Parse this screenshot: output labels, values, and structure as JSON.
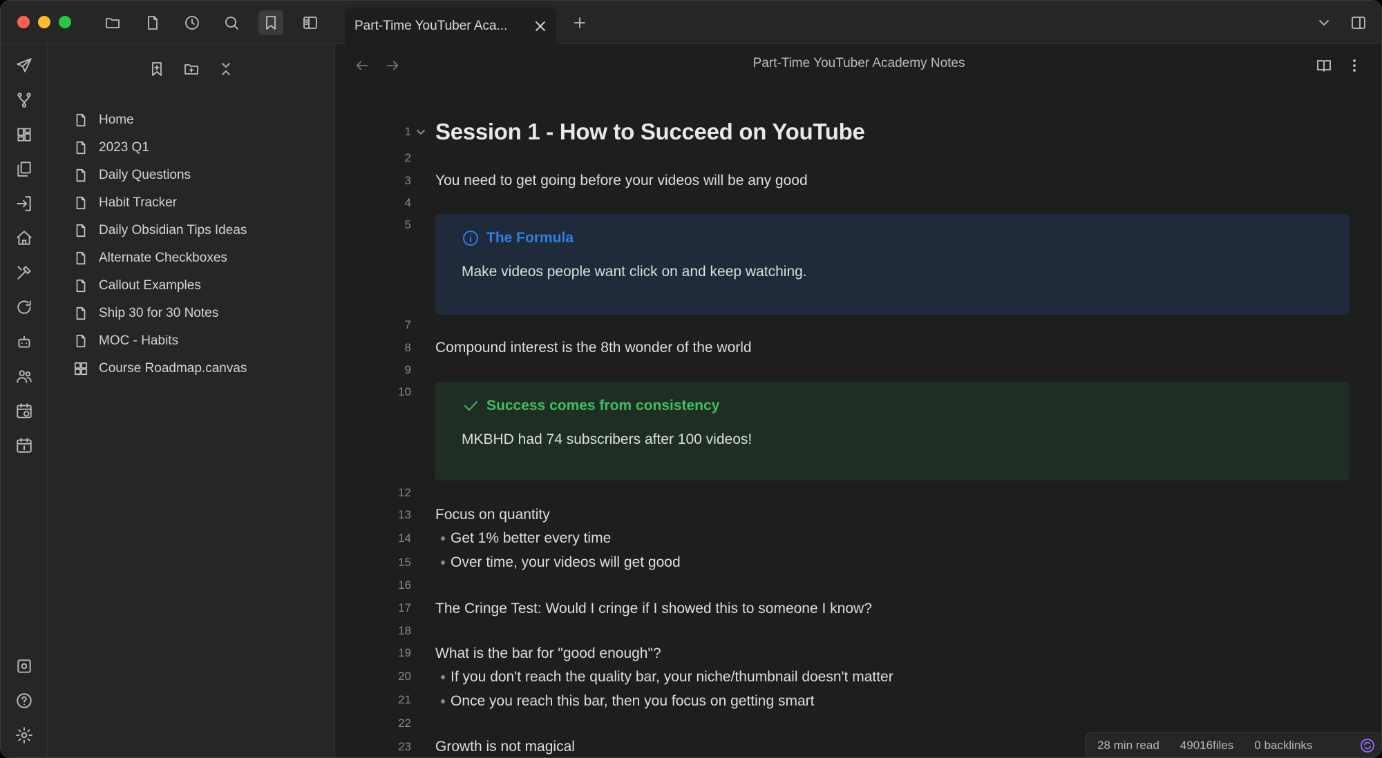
{
  "window": {
    "tab_title": "Part-Time YouTuber Aca...",
    "view_title": "Part-Time YouTuber Academy Notes"
  },
  "titlebar_icons": [
    "folder-icon",
    "file-icon",
    "clock-icon",
    "search-icon",
    "bookmark-icon",
    "sidebar-icon"
  ],
  "ribbon_icons": [
    "send-icon",
    "git-branch-icon",
    "layout-grid-icon",
    "copy-icon",
    "log-in-icon",
    "home-icon",
    "tools-icon",
    "refresh-icon",
    "robot-icon",
    "users-icon",
    "calendar-clock-icon",
    "calendar-day-icon",
    "vault-icon",
    "help-icon",
    "settings-icon"
  ],
  "sidebar": {
    "bookmarks": [
      {
        "label": "Home",
        "icon": "file-icon"
      },
      {
        "label": "2023 Q1",
        "icon": "file-icon"
      },
      {
        "label": "Daily Questions",
        "icon": "file-icon"
      },
      {
        "label": "Habit Tracker",
        "icon": "file-icon"
      },
      {
        "label": "Daily Obsidian Tips Ideas",
        "icon": "file-icon"
      },
      {
        "label": "Alternate Checkboxes",
        "icon": "file-icon"
      },
      {
        "label": "Callout Examples",
        "icon": "file-icon"
      },
      {
        "label": "Ship 30 for 30 Notes",
        "icon": "file-icon"
      },
      {
        "label": "MOC - Habits",
        "icon": "file-icon"
      },
      {
        "label": "Course Roadmap.canvas",
        "icon": "canvas-icon"
      }
    ]
  },
  "editor": {
    "line_numbers": [
      "1",
      "2",
      "3",
      "4",
      "5",
      "7",
      "8",
      "9",
      "10",
      "12",
      "13",
      "14",
      "15",
      "16",
      "17",
      "18",
      "19",
      "20",
      "21",
      "22",
      "23"
    ],
    "heading": "Session 1 - How to Succeed on YouTube",
    "line3": "You need to get going before your videos will be any good",
    "callout_info": {
      "title": "The Formula",
      "body": "Make videos people want click on and keep watching.",
      "color": "#2f7ee6"
    },
    "line8": "Compound interest is the 8th wonder of the world",
    "callout_success": {
      "title": "Success comes from consistency",
      "body": "MKBHD had 74 subscribers after 100 videos!",
      "color": "#3fbf5f"
    },
    "line13": "Focus on quantity",
    "line14": "Get 1% better every time",
    "line15": "Over time, your videos will get good",
    "line17": "The Cringe Test: Would I cringe if I showed this to someone I know?",
    "line19": "What is the bar for \"good enough\"?",
    "line20": "If you don't reach the quality bar, your niche/thumbnail doesn't matter",
    "line21": "Once you reach this bar, then you focus on getting smart",
    "line23": "Growth is not magical"
  },
  "status": {
    "read_time": "28 min read",
    "files": "49016files",
    "backlinks": "0 backlinks"
  }
}
